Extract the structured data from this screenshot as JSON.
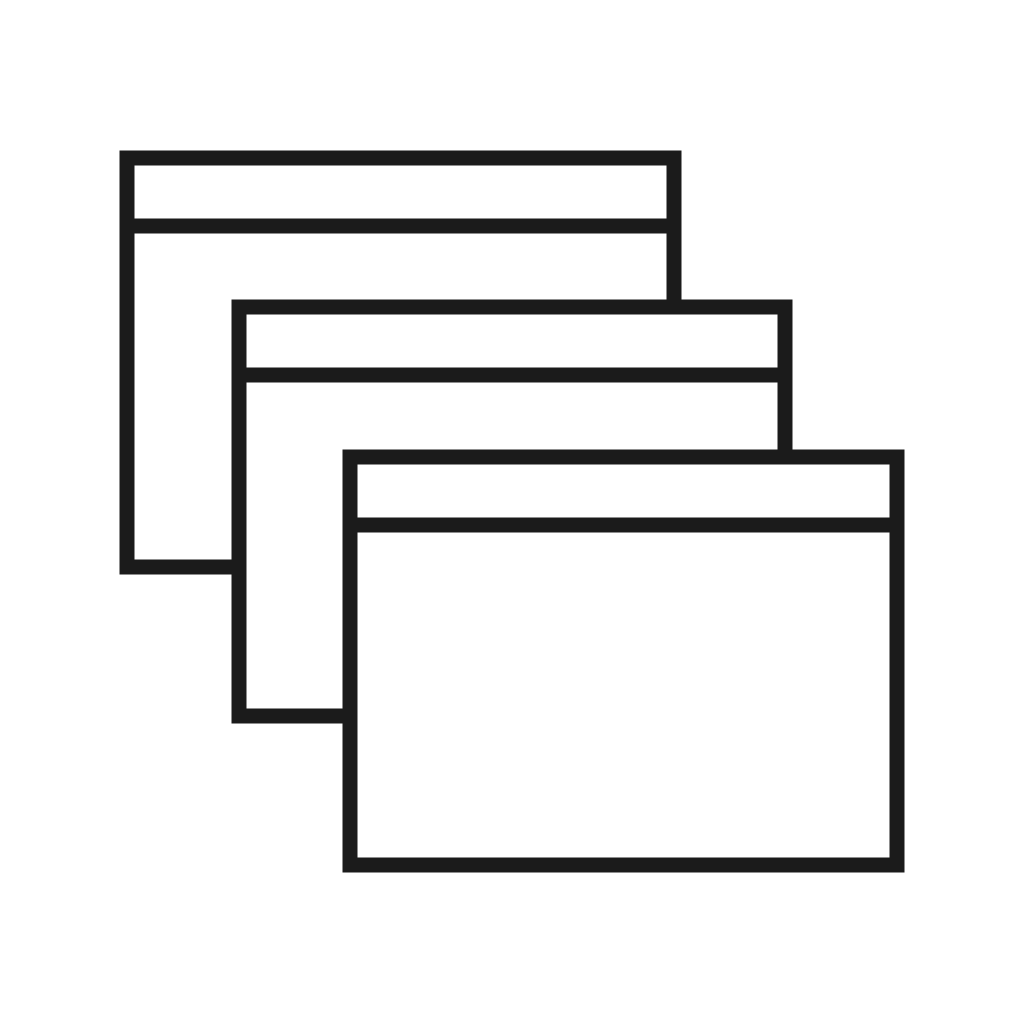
{
  "icon": {
    "name": "stacked-windows-icon",
    "windows": [
      {
        "name": "back-window-icon"
      },
      {
        "name": "middle-window-icon"
      },
      {
        "name": "front-window-icon"
      }
    ]
  },
  "colors": {
    "background": "#ffffff",
    "stroke": "#1b1b1b",
    "fill": "#ffffff"
  }
}
